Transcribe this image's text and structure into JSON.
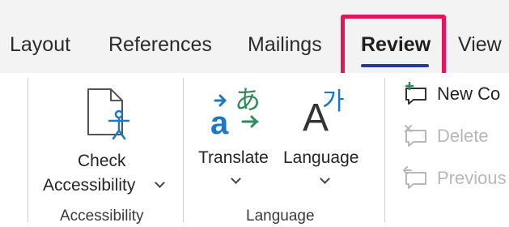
{
  "tabs": {
    "layout": "Layout",
    "references": "References",
    "mailings": "Mailings",
    "review": "Review",
    "view": "View"
  },
  "accessibility": {
    "check_line1": "Check",
    "check_line2": "Accessibility",
    "group_label": "Accessibility"
  },
  "language": {
    "translate_label": "Translate",
    "language_label": "Language",
    "group_label": "Language",
    "translate_icon_text": "a",
    "translate_icon_glyph": "あ",
    "language_icon_text": "A",
    "language_icon_glyph": "가"
  },
  "comments": {
    "new_comment": "New Co",
    "delete": "Delete",
    "previous": "Previous"
  },
  "colors": {
    "highlight": "#e3165b",
    "review_underline": "#1f3f94",
    "icon_blue": "#1b77c8",
    "icon_green": "#2e8b57"
  }
}
